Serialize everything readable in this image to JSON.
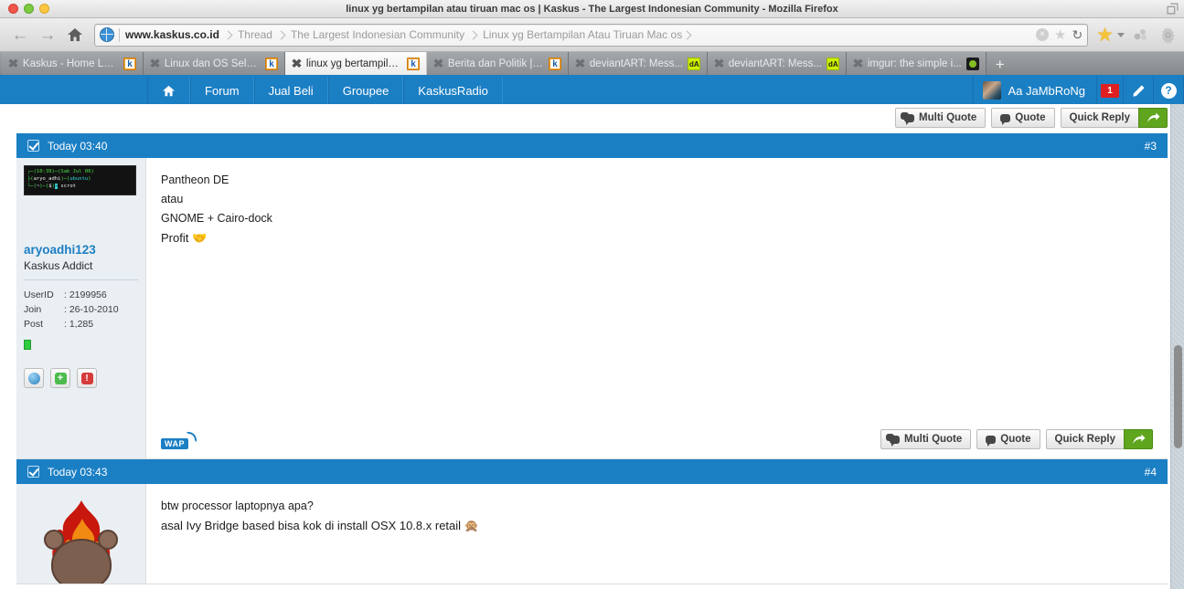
{
  "window": {
    "title": "linux yg bertampilan atau tiruan mac os | Kaskus - The Largest Indonesian Community - Mozilla Firefox"
  },
  "toolbar": {
    "back_icon": "back-arrow-icon",
    "forward_icon": "forward-arrow-icon",
    "home_icon": "home-icon",
    "url_host": "www.kaskus.co.id",
    "breadcrumbs": [
      "Thread",
      "The Largest Indonesian Community",
      "Linux yg Bertampilan Atau Tiruan Mac os"
    ],
    "stop_label": "×",
    "reload_label": "↻",
    "bookmark_star_icon": "star-icon",
    "sync_icon": "sync-icon",
    "settings_icon": "gear-icon"
  },
  "tabs": [
    {
      "label": "Kaskus - Home Login",
      "favicon": "kaskus-favicon",
      "active": false
    },
    {
      "label": "Linux dan OS Selai...",
      "favicon": "kaskus-favicon",
      "active": false
    },
    {
      "label": "linux yg bertampila...",
      "favicon": "kaskus-favicon",
      "active": true
    },
    {
      "label": "Berita dan Politik | ...",
      "favicon": "kaskus-favicon",
      "active": false
    },
    {
      "label": "deviantART: Mess...",
      "favicon": "deviantart-favicon",
      "active": false
    },
    {
      "label": "deviantART: Mess...",
      "favicon": "deviantart-favicon",
      "active": false
    },
    {
      "label": "imgur: the simple i...",
      "favicon": "imgur-favicon",
      "active": false
    }
  ],
  "new_tab_label": "+",
  "site_nav": {
    "home_icon": "home-icon",
    "items": [
      "Forum",
      "Jual Beli",
      "Groupee",
      "KaskusRadio"
    ],
    "username": "Aa JaMbRoNg",
    "notification_count": "1",
    "compose_icon": "pencil-icon",
    "help_icon": "question-mark-icon"
  },
  "top_actions": {
    "multi_quote": "Multi Quote",
    "quote": "Quote",
    "quick_reply": "Quick Reply",
    "reply_arrow_icon": "reply-arrow-icon"
  },
  "posts": [
    {
      "timestamp": "Today 03:40",
      "number": "#3",
      "author": "aryoadhi123",
      "rank": "Kaskus Addict",
      "avatar_type": "terminal-screenshot",
      "avatar_lines": [
        {
          "seg": [
            {
              "t": "┌─",
              "c": "grn"
            },
            {
              "t": "(10:39)",
              "c": "grn"
            },
            {
              "t": "─",
              "c": "wht"
            },
            {
              "t": "(Sab Jul 06)",
              "c": "grn"
            }
          ]
        },
        {
          "seg": [
            {
              "t": "├",
              "c": "grn"
            },
            {
              "t": "(",
              "c": "wht"
            },
            {
              "t": "aryo_adhi",
              "c": "wht"
            },
            {
              "t": ")─(",
              "c": "grn"
            },
            {
              "t": "ubuntu",
              "c": "cyn"
            },
            {
              "t": ")",
              "c": "grn"
            }
          ]
        },
        {
          "seg": [
            {
              "t": "└─(",
              "c": "grn"
            },
            {
              "t": "~",
              "c": "wht"
            },
            {
              "t": ")─(",
              "c": "grn"
            },
            {
              "t": "$",
              "c": "wht"
            },
            {
              "t": ")",
              "c": "grn"
            },
            {
              "t": "»",
              "c": "inv"
            },
            {
              "t": " scrot",
              "c": "wht"
            }
          ]
        }
      ],
      "stats": [
        {
          "key": "UserID",
          "value": ": 2199956"
        },
        {
          "key": "Join",
          "value": ": 26-10-2010"
        },
        {
          "key": "Post",
          "value": ": 1,285"
        }
      ],
      "online_status": "online",
      "action_icons": [
        "profile-icon",
        "add-friend-icon",
        "report-icon"
      ],
      "body_lines": [
        "Pantheon DE",
        "atau",
        "GNOME + Cairo-dock",
        "Profit 🤝"
      ],
      "wap_label": "WAP",
      "actions": {
        "multi_quote": "Multi Quote",
        "quote": "Quote",
        "quick_reply": "Quick Reply",
        "reply_arrow_icon": "reply-arrow-icon"
      }
    },
    {
      "timestamp": "Today 03:43",
      "number": "#4",
      "avatar_type": "burning-bear",
      "body_lines": [
        "btw processor laptopnya apa?",
        "asal Ivy Bridge based bisa kok di install OSX 10.8.x retail 🙊"
      ]
    }
  ],
  "colors": {
    "brand_blue": "#1b7fc4",
    "green_button": "#5fa51e",
    "badge_red": "#e02020",
    "link_blue": "#1b7fc4",
    "sidebar_bg": "#eaeff3"
  }
}
